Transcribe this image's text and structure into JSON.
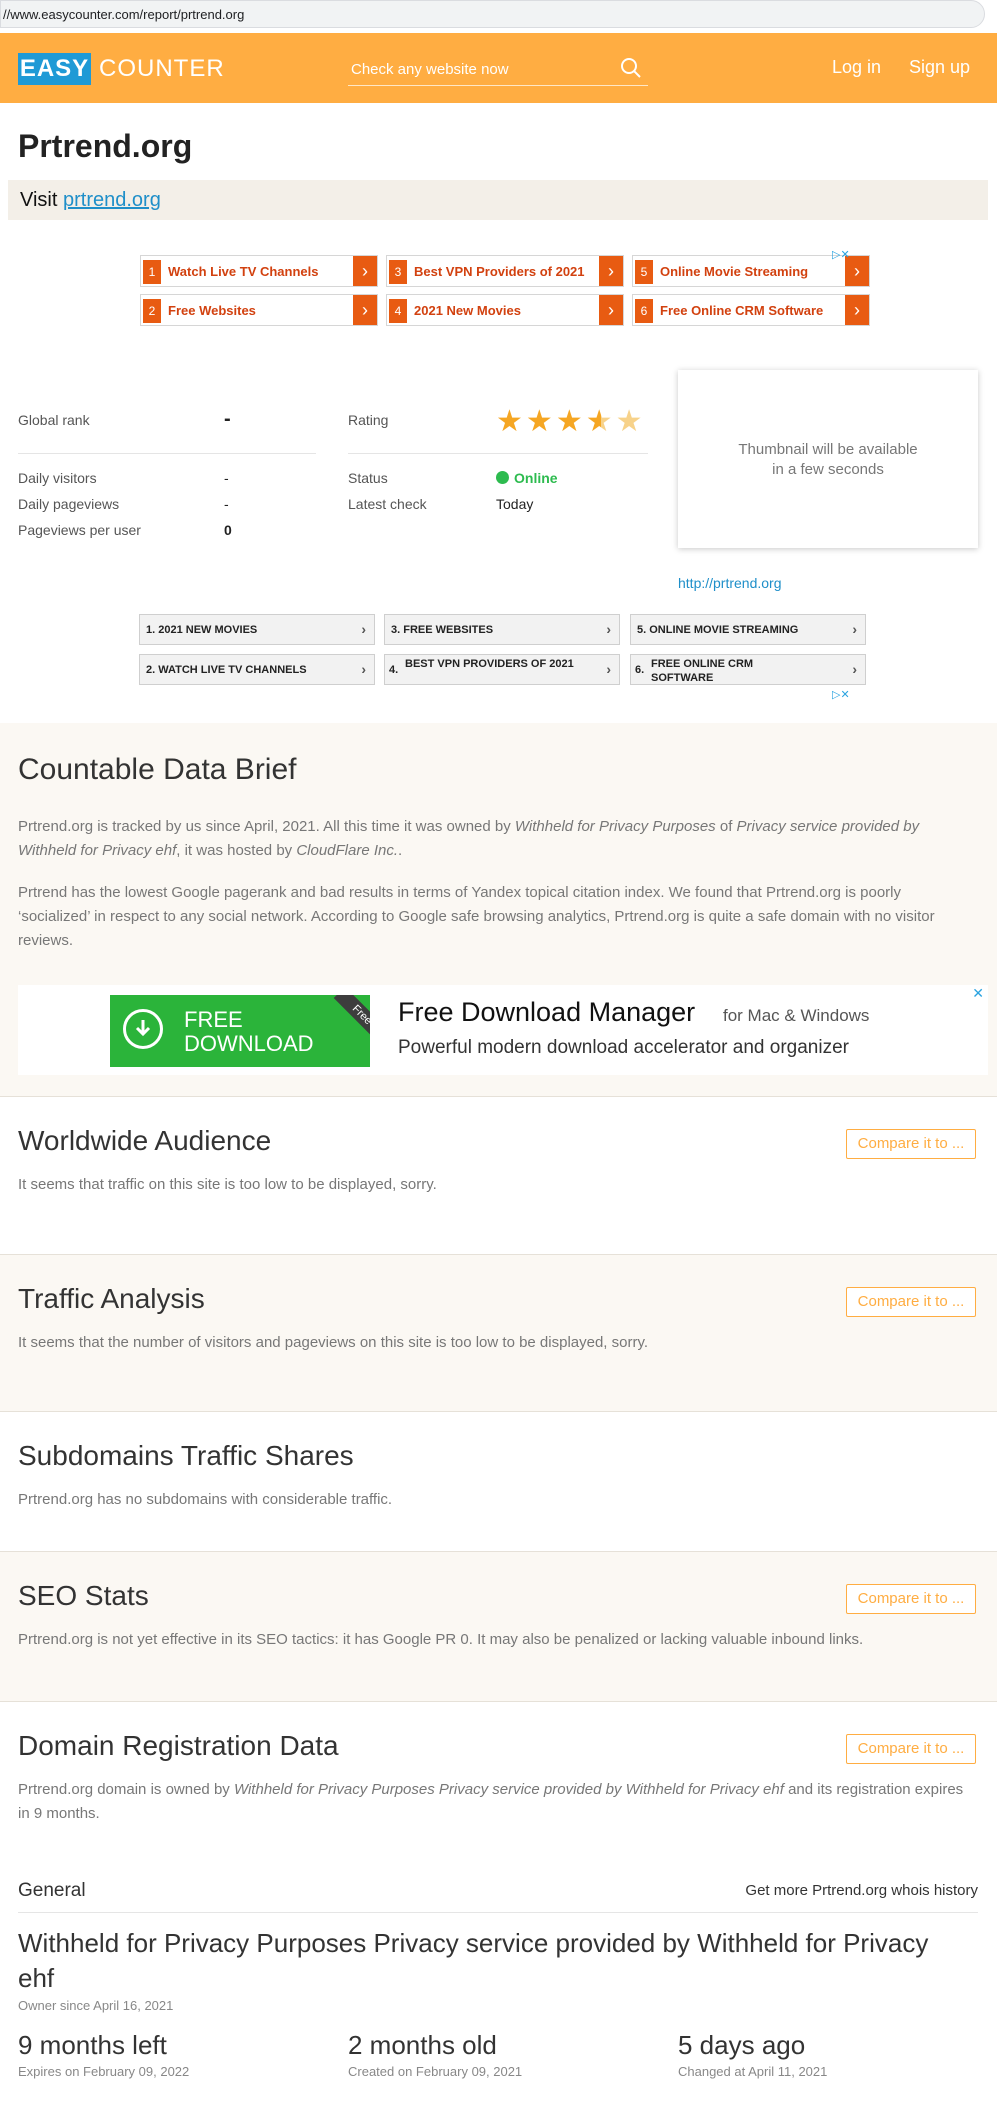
{
  "browser": {
    "url": "//www.easycounter.com/report/prtrend.org"
  },
  "header": {
    "logo_box": "EASY",
    "logo_text": "COUNTER",
    "search_placeholder": "Check any website now",
    "login": "Log in",
    "signup": "Sign up"
  },
  "site": {
    "title": "Prtrend.org",
    "visit_prefix": "Visit",
    "visit_link": "prtrend.org"
  },
  "ad_top": [
    {
      "num": "1",
      "label": "Watch Live TV Channels"
    },
    {
      "num": "3",
      "label": "Best VPN Providers of 2021"
    },
    {
      "num": "5",
      "label": "Online Movie Streaming"
    },
    {
      "num": "2",
      "label": "Free Websites"
    },
    {
      "num": "4",
      "label": "2021 New Movies"
    },
    {
      "num": "6",
      "label": "Free Online CRM Software"
    }
  ],
  "stats": {
    "global_rank_label": "Global rank",
    "global_rank_value": "-",
    "rating_label": "Rating",
    "rating_value": 3.5,
    "daily_visitors_label": "Daily visitors",
    "daily_visitors_value": "-",
    "daily_pageviews_label": "Daily pageviews",
    "daily_pageviews_value": "-",
    "ppu_label": "Pageviews per user",
    "ppu_value": "0",
    "status_label": "Status",
    "status_value": "Online",
    "latest_check_label": "Latest check",
    "latest_check_value": "Today",
    "thumbnail_line1": "Thumbnail will be available",
    "thumbnail_line2": "in a few seconds",
    "thumb_link": "http://prtrend.org"
  },
  "ad_bottom": [
    {
      "label": "1. 2021 NEW MOVIES"
    },
    {
      "label": "3. FREE WEBSITES"
    },
    {
      "label": "5. ONLINE MOVIE STREAMING"
    },
    {
      "label": "2. WATCH LIVE TV CHANNELS"
    },
    {
      "num": "4.",
      "label": "BEST VPN PROVIDERS OF 2021"
    },
    {
      "num": "6.",
      "label": "FREE ONLINE CRM SOFTWARE"
    }
  ],
  "brief": {
    "title": "Countable Data Brief",
    "p1_a": "Prtrend.org is tracked by us since April, 2021. All this time it was owned by ",
    "p1_b": "Withheld for Privacy Purposes",
    "p1_c": " of ",
    "p1_d": "Privacy service provided by Withheld for Privacy ehf",
    "p1_e": ", it was hosted by ",
    "p1_f": "CloudFlare Inc.",
    "p1_g": ".",
    "p2": "Prtrend has the lowest Google pagerank and bad results in terms of Yandex topical citation index. We found that Prtrend.org is poorly ‘socialized’ in respect to any social network. According to Google safe browsing analytics, Prtrend.org is quite a safe domain with no visitor reviews."
  },
  "fdm_ad": {
    "btn_line1": "FREE",
    "btn_line2": "DOWNLOAD",
    "ribbon": "Free",
    "title": "Free Download Manager",
    "for": "for Mac & Windows",
    "sub": "Powerful modern download accelerator and organizer",
    "close": "✕"
  },
  "sections": {
    "compare_label": "Compare it to ...",
    "audience_title": "Worldwide Audience",
    "audience_text": "It seems that traffic on this site is too low to be displayed, sorry.",
    "traffic_title": "Traffic Analysis",
    "traffic_text": "It seems that the number of visitors and pageviews on this site is too low to be displayed, sorry.",
    "subdomains_title": "Subdomains Traffic Shares",
    "subdomains_text": "Prtrend.org has no subdomains with considerable traffic.",
    "seo_title": "SEO Stats",
    "seo_text": "Prtrend.org is not yet effective in its SEO tactics: it has Google PR 0. It may also be penalized or lacking valuable inbound links.",
    "domain_title": "Domain Registration Data",
    "domain_text_a": "Prtrend.org domain is owned by ",
    "domain_text_b": "Withheld for Privacy Purposes Privacy service provided by Withheld for Privacy ehf",
    "domain_text_c": " and its registration expires in 9 months."
  },
  "general": {
    "label": "General",
    "more_prefix": "Get more ",
    "more_link": "Prtrend.org whois history",
    "owner": "Withheld for Privacy Purposes Privacy service provided by Withheld for Privacy ehf",
    "owner_since": "Owner since April 16, 2021",
    "left_big": "9 months left",
    "left_small": "Expires on February 09, 2022",
    "old_big": "2 months old",
    "old_small": "Created on February 09, 2021",
    "ago_big": "5 days ago",
    "ago_small": "Changed at April 11, 2021"
  },
  "colors": {
    "brand": "#ffad42",
    "logo": "#1f9ad6",
    "link": "#1f8fc9",
    "ad_orange": "#e85b12",
    "online": "#2dbb4f"
  }
}
